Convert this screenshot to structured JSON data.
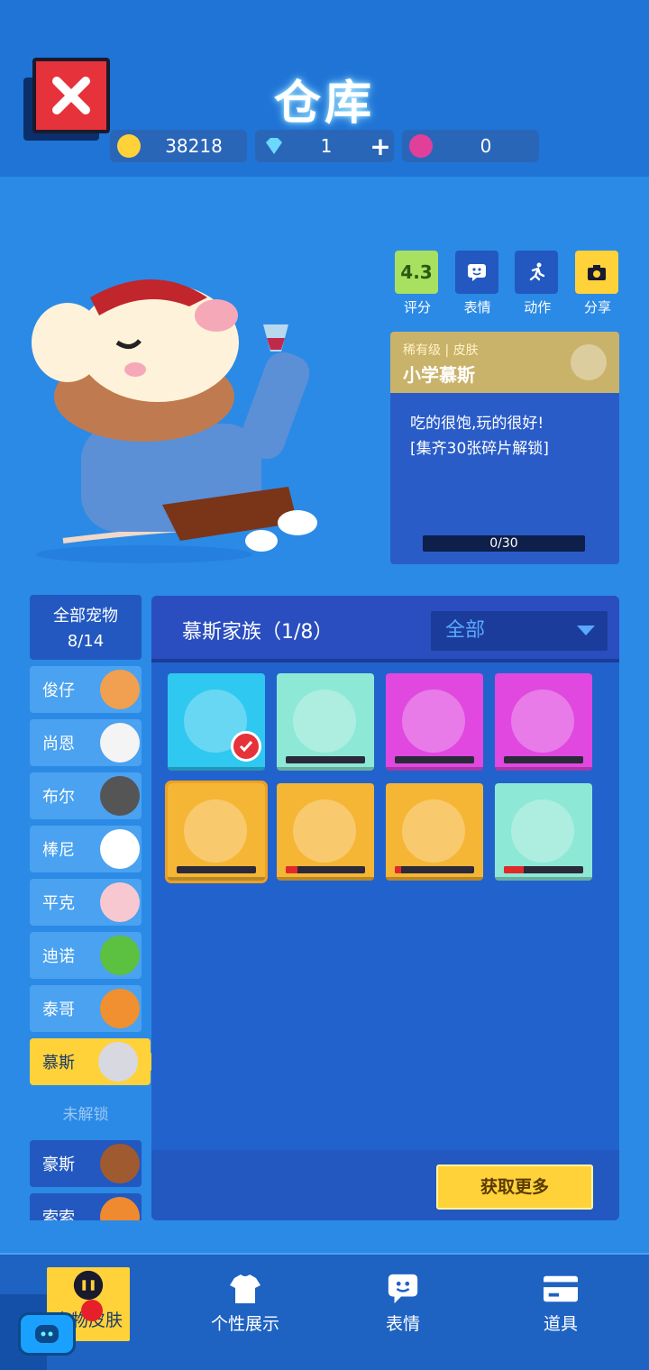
{
  "header": {
    "title": "仓库",
    "currencies": [
      {
        "icon": "coin-icon",
        "value": "38218",
        "color": "#ffd23a"
      },
      {
        "icon": "diamond-icon",
        "value": "1",
        "add": "+",
        "color": "#6cd8ff"
      },
      {
        "icon": "lotus-icon",
        "value": "0",
        "color": "#e0409a"
      }
    ]
  },
  "actions": [
    {
      "label": "评分",
      "value": "4.3"
    },
    {
      "label": "表情",
      "icon": "emoji-icon"
    },
    {
      "label": "动作",
      "icon": "run-icon"
    },
    {
      "label": "分享",
      "icon": "camera-icon"
    }
  ],
  "skin": {
    "rarity": "稀有级 | 皮肤",
    "name": "小学慕斯",
    "desc1": "吃的很饱,玩的很好!",
    "desc2": "[集齐30张碎片解锁]",
    "progress": "0/30"
  },
  "sidebar": {
    "all_label": "全部宠物",
    "all_count": "8/14",
    "items": [
      {
        "label": "俊仔"
      },
      {
        "label": "尚恩"
      },
      {
        "label": "布尔"
      },
      {
        "label": "棒尼"
      },
      {
        "label": "平克"
      },
      {
        "label": "迪诺"
      },
      {
        "label": "泰哥"
      },
      {
        "label": "慕斯"
      }
    ],
    "locked_label": "未解锁",
    "locked_items": [
      {
        "label": "豪斯"
      },
      {
        "label": "索索"
      }
    ]
  },
  "family": {
    "title": "慕斯家族（1/8）",
    "filter": "全部",
    "get_more": "获取更多"
  },
  "tabs": [
    {
      "label": "宠物皮肤",
      "icon": "pet-skin-icon"
    },
    {
      "label": "个性展示",
      "icon": "shirt-icon"
    },
    {
      "label": "表情",
      "icon": "emoji-icon"
    },
    {
      "label": "道具",
      "icon": "card-icon"
    }
  ],
  "colors": {
    "accent": "#ffd23a",
    "close": "#e6323a",
    "background": "#2b8ae6"
  },
  "skin_tiles": [
    {
      "color": "#2fc8f0",
      "owned": true,
      "progress": 1
    },
    {
      "color": "#8ee8d6",
      "progress": 0
    },
    {
      "color": "#e048e0",
      "progress": 0
    },
    {
      "color": "#e048e0",
      "progress": 0
    },
    {
      "color": "#f5b635",
      "progress": 0
    },
    {
      "color": "#f5b635",
      "progress": 0.15
    },
    {
      "color": "#f5b635",
      "progress": 0.08
    },
    {
      "color": "#8ee8d6",
      "progress": 0.25
    }
  ]
}
